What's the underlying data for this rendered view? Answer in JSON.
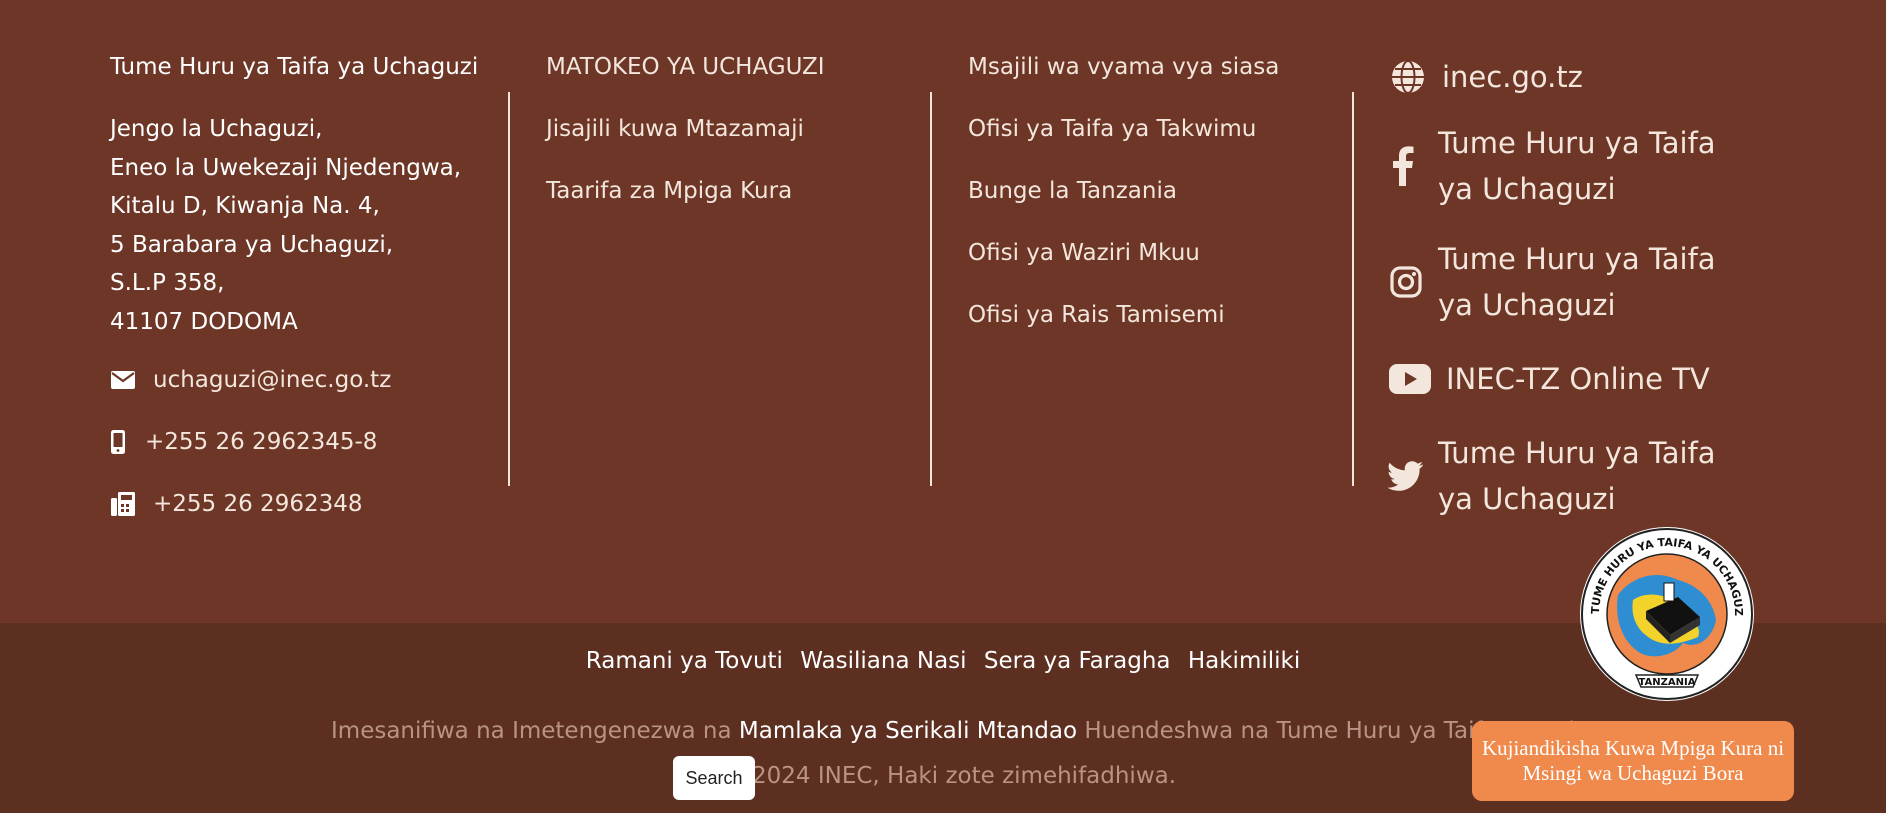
{
  "colors": {
    "background": "#6d3626",
    "bottom_bar": "#5c2f21",
    "accent_button": "#ef8a4c",
    "muted_text": "#b99383"
  },
  "contact": {
    "title": "Tume Huru ya Taifa ya Uchaguzi",
    "address_lines": [
      "Jengo la Uchaguzi,",
      "Eneo la Uwekezaji Njedengwa,",
      "Kitalu D, Kiwanja Na. 4,",
      "5 Barabara ya Uchaguzi,",
      "S.L.P 358,",
      "41107 DODOMA"
    ],
    "email": "uchaguzi@inec.go.tz",
    "phone": "+255 26 2962345-8",
    "fax": "+255 26 2962348"
  },
  "links_col2": [
    "MATOKEO YA UCHAGUZI",
    "Jisajili kuwa Mtazamaji",
    "Taarifa za Mpiga Kura"
  ],
  "links_col3": [
    "Msajili wa vyama vya siasa",
    "Ofisi ya Taifa ya Takwimu",
    "Bunge la Tanzania",
    "Ofisi ya Waziri Mkuu",
    "Ofisi ya Rais Tamisemi"
  ],
  "social": {
    "website": "inec.go.tz",
    "facebook": "Tume Huru ya Taifa ya Uchaguzi",
    "instagram": "Tume Huru ya Taifa ya Uchaguzi",
    "youtube": "INEC-TZ Online TV",
    "twitter": "Tume Huru ya Taifa ya Uchaguzi"
  },
  "bottom_links": [
    "Ramani ya Tovuti",
    "Wasiliana Nasi",
    "Sera ya Faragha",
    "Hakimiliki"
  ],
  "credit": {
    "prefix": "Imesanifiwa na Imetengenezwa na",
    "agency": "Mamlaka ya Serikali Mtandao",
    "suffix": "Huendeshwa na Tume Huru ya Taifa ya Uch"
  },
  "copyright": "2024 INEC, Haki zote zimehifadhiwa.",
  "search_button": "Search",
  "register_button": "Kujiandikisha Kuwa Mpiga Kura ni Msingi wa Uchaguzi Bora",
  "seal": {
    "ring_text": "TUME HURU YA TAIFA YA UCHAGUZI",
    "banner": "TANZANIA"
  }
}
